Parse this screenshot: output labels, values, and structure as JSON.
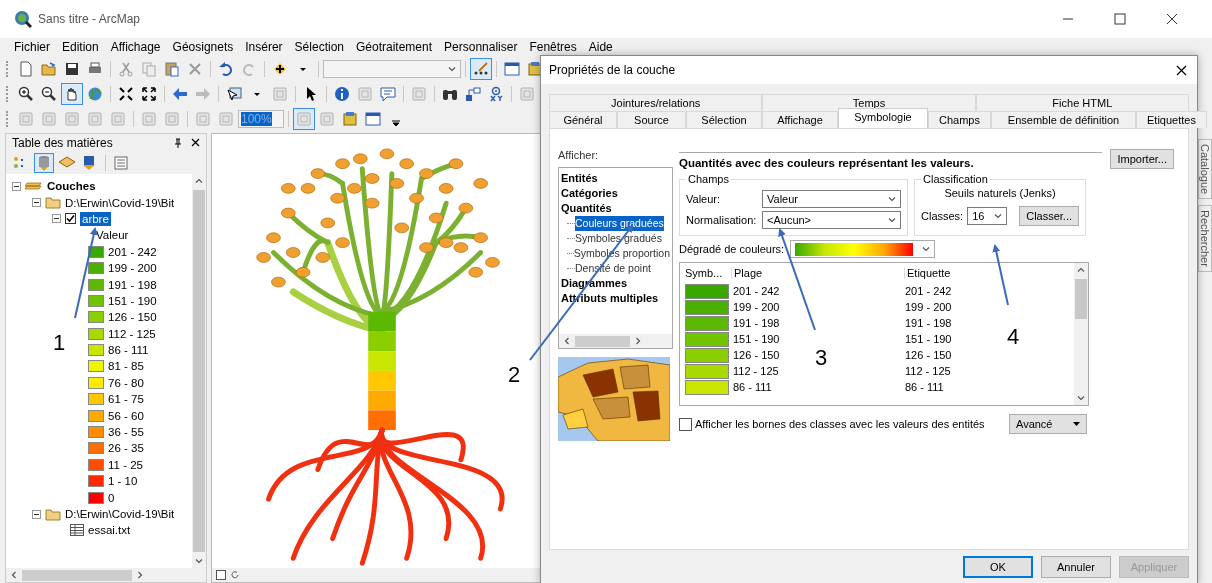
{
  "window": {
    "title": "Sans titre - ArcMap"
  },
  "menu": [
    "Fichier",
    "Edition",
    "Affichage",
    "Géosignets",
    "Insérer",
    "Sélection",
    "Géotraitement",
    "Personnaliser",
    "Fenêtres",
    "Aide"
  ],
  "layout_zoom": "100%",
  "toc": {
    "title": "Table des matières",
    "tree": [
      {
        "kind": "group",
        "label": "Couches",
        "expanded": true,
        "children": [
          {
            "kind": "folder",
            "label": "D:\\Erwin\\Covid-19\\Bit",
            "expanded": true,
            "children": [
              {
                "kind": "layer",
                "label": "arbre",
                "expanded": true,
                "checked": true,
                "selected": true,
                "field": "Valeur",
                "legend": [
                  {
                    "label": "201 - 242",
                    "color": "#38a800"
                  },
                  {
                    "label": "199 - 200",
                    "color": "#4cb000"
                  },
                  {
                    "label": "191 - 198",
                    "color": "#5cb800"
                  },
                  {
                    "label": "151 - 190",
                    "color": "#70c400"
                  },
                  {
                    "label": "126 - 150",
                    "color": "#8ccf00"
                  },
                  {
                    "label": "112 - 125",
                    "color": "#a8d900"
                  },
                  {
                    "label": "86 - 111",
                    "color": "#c8e600"
                  },
                  {
                    "label": "81 - 85",
                    "color": "#eef500"
                  },
                  {
                    "label": "76 - 80",
                    "color": "#ffeb00"
                  },
                  {
                    "label": "61 - 75",
                    "color": "#ffc800"
                  },
                  {
                    "label": "56 - 60",
                    "color": "#ffaa00"
                  },
                  {
                    "label": "36 - 55",
                    "color": "#ff8c00"
                  },
                  {
                    "label": "26 - 35",
                    "color": "#ff6e00"
                  },
                  {
                    "label": "11 - 25",
                    "color": "#ff4d00"
                  },
                  {
                    "label": "1 - 10",
                    "color": "#ff2a00"
                  },
                  {
                    "label": "0",
                    "color": "#ff0000"
                  }
                ]
              }
            ]
          },
          {
            "kind": "folder",
            "label": "D:\\Erwin\\Covid-19\\Bit",
            "expanded": true,
            "children": [
              {
                "kind": "table",
                "label": "essai.txt"
              }
            ]
          }
        ]
      }
    ]
  },
  "dialog": {
    "title": "Propriétés de la couche",
    "tab_rows": [
      [
        {
          "label": "Jointures/relations",
          "selected": false
        },
        {
          "label": "Temps",
          "selected": false
        },
        {
          "label": "Fiche HTML",
          "selected": false
        }
      ],
      [
        {
          "label": "Général",
          "selected": false
        },
        {
          "label": "Source",
          "selected": false
        },
        {
          "label": "Sélection",
          "selected": false
        },
        {
          "label": "Affichage",
          "selected": false
        },
        {
          "label": "Symbologie",
          "selected": true
        },
        {
          "label": "Champs",
          "selected": false
        },
        {
          "label": "Ensemble de définition",
          "selected": false
        },
        {
          "label": "Etiquettes",
          "selected": false
        }
      ]
    ],
    "show_label": "Afficher:",
    "show_list": [
      {
        "label": "Entités",
        "selected": false
      },
      {
        "label": "Catégories",
        "selected": false
      },
      {
        "label": "Quantités",
        "selected": false,
        "children": [
          {
            "label": "Couleurs graduées",
            "selected": true
          },
          {
            "label": "Symboles gradués",
            "selected": false
          },
          {
            "label": "Symboles proportion",
            "selected": false
          },
          {
            "label": "Densité de point",
            "selected": false
          }
        ]
      },
      {
        "label": "Diagrammes",
        "selected": false
      },
      {
        "label": "Attributs multiples",
        "selected": false
      }
    ],
    "description": "Quantités avec des couleurs représentant les valeurs.",
    "import_button": "Importer...",
    "fields": {
      "title": "Champs",
      "value_label": "Valeur:",
      "value": "Valeur",
      "normalization_label": "Normalisation:",
      "normalization": "<Aucun>"
    },
    "classification": {
      "title": "Classification",
      "method": "Seuils naturels (Jenks)",
      "classes_label": "Classes:",
      "classes": "16",
      "classify_button": "Classer..."
    },
    "ramp_label": "Dégradé de couleurs:",
    "table": {
      "columns": [
        "Symb...",
        "Plage",
        "Etiquette"
      ],
      "rows": [
        {
          "color": "#38a800",
          "range": "201 - 242",
          "label": "201 - 242"
        },
        {
          "color": "#4cb000",
          "range": "199 - 200",
          "label": "199 - 200"
        },
        {
          "color": "#5cb800",
          "range": "191 - 198",
          "label": "191 - 198"
        },
        {
          "color": "#70c400",
          "range": "151 - 190",
          "label": "151 - 190"
        },
        {
          "color": "#8ccf00",
          "range": "126 - 150",
          "label": "126 - 150"
        },
        {
          "color": "#a8d900",
          "range": "112 - 125",
          "label": "112 - 125"
        },
        {
          "color": "#c8e600",
          "range": "86 - 111",
          "label": "86 - 111"
        }
      ]
    },
    "show_bounds": {
      "label": "Afficher les bornes des classes avec les valeurs des entités",
      "checked": false
    },
    "advanced_button": "Avancé",
    "buttons": [
      {
        "label": "OK",
        "default": true,
        "disabled": false
      },
      {
        "label": "Annuler",
        "default": false,
        "disabled": false
      },
      {
        "label": "Appliquer",
        "default": false,
        "disabled": true
      }
    ]
  },
  "dock_tabs": [
    "Catalogue",
    "Rechercher"
  ],
  "annotations": [
    "1",
    "2",
    "3",
    "4"
  ]
}
